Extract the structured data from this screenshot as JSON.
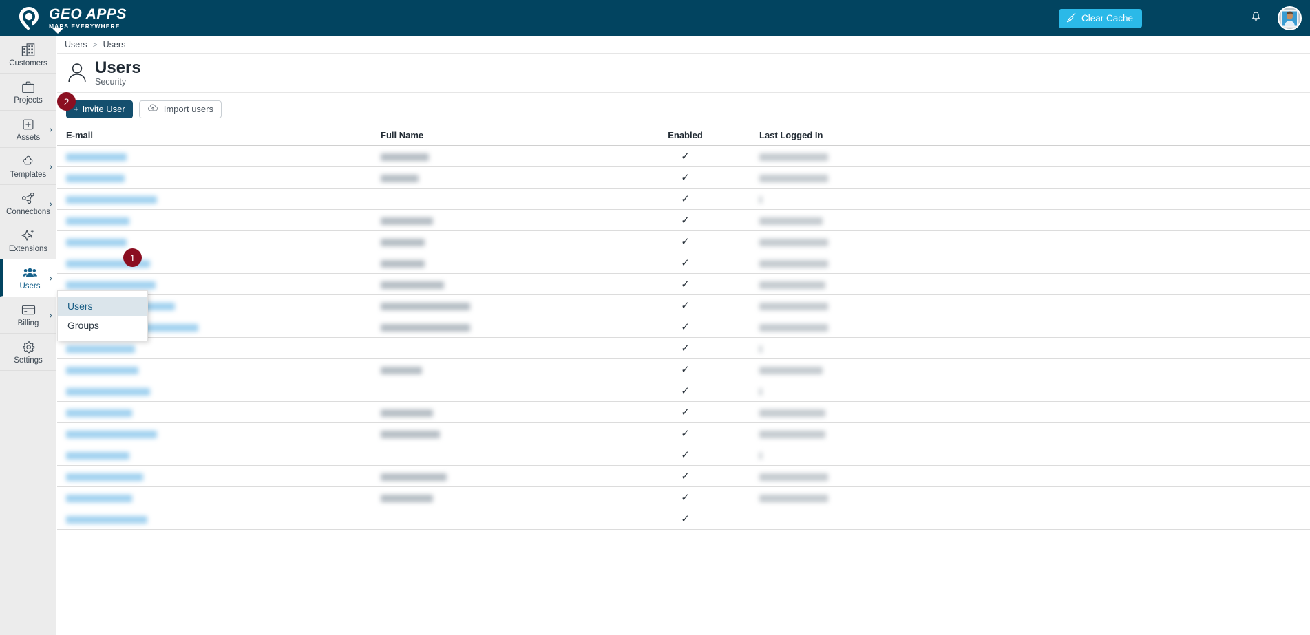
{
  "topbar": {
    "logo_title": "GEO APPS",
    "logo_sub": "MAPS EVERYWHERE",
    "logo_icon": "map-pin-icon",
    "clear_cache_label": "Clear Cache",
    "clear_cache_icon": "broom-icon",
    "clear_cache_color": "#2bb9e8",
    "notifications_icon": "bell-icon",
    "avatar_icon": "user-avatar",
    "background_color": "#024460"
  },
  "sidebar": {
    "items": [
      {
        "label": "Customers",
        "icon": "buildings-icon",
        "has_chevron": false,
        "active": false
      },
      {
        "label": "Projects",
        "icon": "briefcase-icon",
        "has_chevron": false,
        "active": false
      },
      {
        "label": "Assets",
        "icon": "plus-square-icon",
        "has_chevron": true,
        "active": false
      },
      {
        "label": "Templates",
        "icon": "puzzle-icon",
        "has_chevron": true,
        "active": false
      },
      {
        "label": "Connections",
        "icon": "network-icon",
        "has_chevron": true,
        "active": false
      },
      {
        "label": "Extensions",
        "icon": "sparkle-icon",
        "has_chevron": false,
        "active": false
      },
      {
        "label": "Users",
        "icon": "users-icon",
        "has_chevron": true,
        "active": true
      },
      {
        "label": "Billing",
        "icon": "credit-card-icon",
        "has_chevron": true,
        "active": false
      },
      {
        "label": "Settings",
        "icon": "gear-icon",
        "has_chevron": false,
        "active": false
      }
    ]
  },
  "flyout": {
    "items": [
      {
        "label": "Users",
        "selected": true
      },
      {
        "label": "Groups",
        "selected": false
      }
    ]
  },
  "badges": [
    {
      "label": "1",
      "color": "#8b0f21"
    },
    {
      "label": "2",
      "color": "#8b0f21"
    }
  ],
  "breadcrumb": {
    "parent": "Users",
    "separator": ">",
    "current": "Users"
  },
  "page": {
    "icon": "person-icon",
    "title": "Users",
    "subtitle": "Security"
  },
  "actions": {
    "invite_label": "Invite User",
    "invite_icon": "plus-icon",
    "import_label": "Import users",
    "import_icon": "cloud-upload-icon"
  },
  "table": {
    "columns": [
      "E-mail",
      "Full Name",
      "Enabled",
      "Last Logged In"
    ],
    "rows": [
      {
        "email": 88,
        "name": 70,
        "enabled": true,
        "last": 100
      },
      {
        "email": 85,
        "name": 55,
        "enabled": true,
        "last": 100
      },
      {
        "email": 132,
        "name": 0,
        "enabled": true,
        "last": 4
      },
      {
        "email": 92,
        "name": 76,
        "enabled": true,
        "last": 92
      },
      {
        "email": 88,
        "name": 64,
        "enabled": true,
        "last": 100
      },
      {
        "email": 122,
        "name": 64,
        "enabled": true,
        "last": 100
      },
      {
        "email": 130,
        "name": 92,
        "enabled": true,
        "last": 96
      },
      {
        "email": 158,
        "name": 130,
        "enabled": true,
        "last": 100
      },
      {
        "email": 192,
        "name": 130,
        "enabled": true,
        "last": 100
      },
      {
        "email": 100,
        "name": 0,
        "enabled": true,
        "last": 4
      },
      {
        "email": 105,
        "name": 60,
        "enabled": true,
        "last": 92
      },
      {
        "email": 122,
        "name": 0,
        "enabled": true,
        "last": 4
      },
      {
        "email": 96,
        "name": 76,
        "enabled": true,
        "last": 96
      },
      {
        "email": 132,
        "name": 86,
        "enabled": true,
        "last": 96
      },
      {
        "email": 92,
        "name": 0,
        "enabled": true,
        "last": 4
      },
      {
        "email": 112,
        "name": 96,
        "enabled": true,
        "last": 100
      },
      {
        "email": 96,
        "name": 76,
        "enabled": true,
        "last": 100
      },
      {
        "email": 118,
        "name": 0,
        "enabled": true,
        "last": 0
      }
    ],
    "checkmark": "✓"
  }
}
